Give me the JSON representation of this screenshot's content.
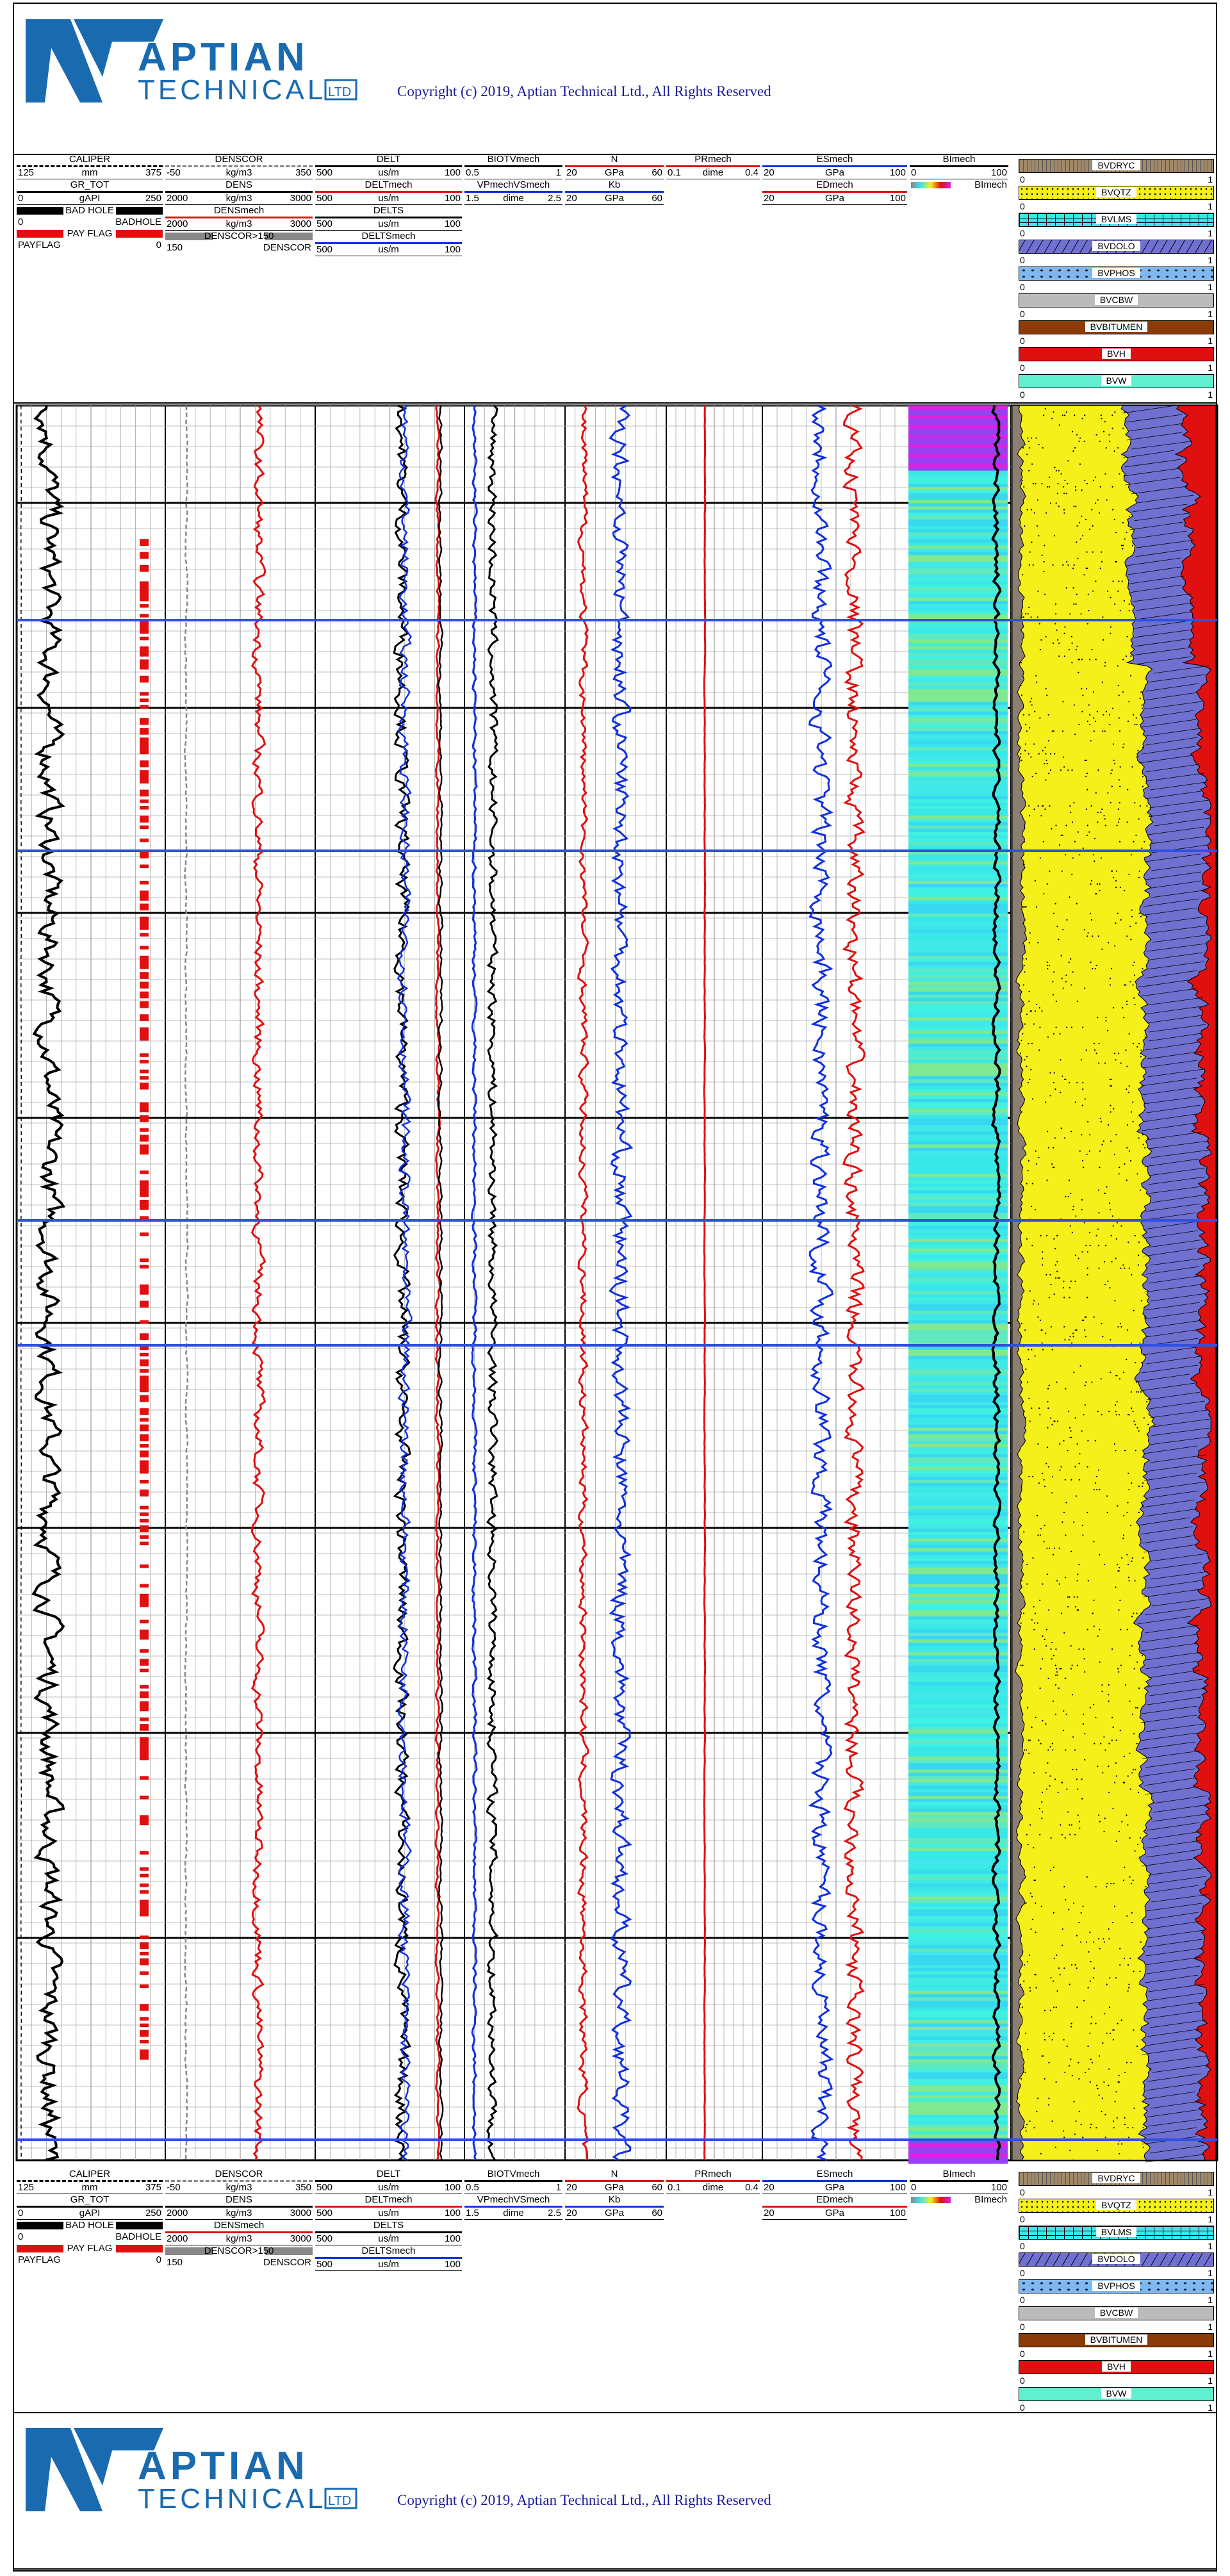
{
  "company": {
    "name": "APTIAN",
    "sub": "TECHNICAL",
    "ltd": "LTD"
  },
  "copyright": "Copyright (c) 2019, Aptian Technical Ltd., All Rights Reserved",
  "colors": {
    "red": "#e01010",
    "blue": "#1030e0",
    "yellow": "#f5f01a",
    "dolo": "#7070d0",
    "cyan": "#38e8e8",
    "brown": "#8b3a0a",
    "bvw": "#60f0d0",
    "gray": "#bbbbbb"
  },
  "tracks": [
    {
      "key": "t1",
      "rows": [
        {
          "name": "CALIPER",
          "unit": "mm",
          "min": "125",
          "max": "375",
          "color": "#000000",
          "dash": true
        },
        {
          "name": "GR_TOT",
          "unit": "gAPI",
          "min": "0",
          "max": "250",
          "color": "#000000"
        },
        {
          "name": "BAD HOLE",
          "unit": "",
          "min": "0",
          "max": "BADHOLE",
          "color": "#000000",
          "flag": true
        },
        {
          "name": "PAY FLAG",
          "unit": "",
          "min": "PAYFLAG",
          "max": "0",
          "color": "#e01010",
          "flag": true
        }
      ]
    },
    {
      "key": "t2",
      "rows": [
        {
          "name": "DENSCOR",
          "unit": "kg/m3",
          "min": "-50",
          "max": "350",
          "color": "#888888",
          "dash": true
        },
        {
          "name": "DENS",
          "unit": "kg/m3",
          "min": "2000",
          "max": "3000",
          "color": "#000000"
        },
        {
          "name": "DENSmech",
          "unit": "kg/m3",
          "min": "2000",
          "max": "3000",
          "color": "#e01010"
        },
        {
          "name": "DENSCOR>150",
          "unit": "",
          "min": "150",
          "max": "DENSCOR",
          "color": "#888888",
          "flag": true
        }
      ]
    },
    {
      "key": "t3",
      "rows": [
        {
          "name": "DELT",
          "unit": "us/m",
          "min": "500",
          "max": "100",
          "color": "#000000"
        },
        {
          "name": "DELTmech",
          "unit": "us/m",
          "min": "500",
          "max": "100",
          "color": "#e01010"
        },
        {
          "name": "DELTS",
          "unit": "us/m",
          "min": "500",
          "max": "100",
          "color": "#000000"
        },
        {
          "name": "DELTSmech",
          "unit": "us/m",
          "min": "500",
          "max": "100",
          "color": "#1030e0"
        }
      ]
    },
    {
      "key": "t4",
      "rows": [
        {
          "name": "BIOTVmech",
          "unit": "",
          "min": "0.5",
          "max": "1",
          "color": "#000000"
        },
        {
          "name": "VPmechVSmech",
          "unit": "dime",
          "min": "1.5",
          "max": "2.5",
          "color": "#1030e0"
        }
      ]
    },
    {
      "key": "t5",
      "rows": [
        {
          "name": "N",
          "unit": "GPa",
          "min": "20",
          "max": "60",
          "color": "#e01010"
        },
        {
          "name": "Kb",
          "unit": "GPa",
          "min": "20",
          "max": "60",
          "color": "#1030e0"
        }
      ]
    },
    {
      "key": "t6",
      "rows": [
        {
          "name": "PRmech",
          "unit": "dime",
          "min": "0.1",
          "max": "0.4",
          "color": "#e01010"
        }
      ]
    },
    {
      "key": "t7",
      "rows": [
        {
          "name": "ESmech",
          "unit": "GPa",
          "min": "20",
          "max": "100",
          "color": "#1030e0"
        },
        {
          "name": "EDmech",
          "unit": "GPa",
          "min": "20",
          "max": "100",
          "color": "#e01010"
        }
      ]
    },
    {
      "key": "t8",
      "rows": [
        {
          "name": "BImech",
          "unit": "",
          "min": "0",
          "max": "100",
          "color": "#000000"
        },
        {
          "name": "",
          "unit": "",
          "min": "0",
          "max": "BImech",
          "color": "#000000",
          "gradient": true
        }
      ]
    }
  ],
  "legend": [
    {
      "name": "BVDRYC",
      "color": "#a0896a",
      "min": "0",
      "max": "1"
    },
    {
      "name": "BVQTZ",
      "color": "#f5f01a",
      "min": "0",
      "max": "1"
    },
    {
      "name": "BVLMS",
      "color": "#38e8e8",
      "min": "0",
      "max": "1"
    },
    {
      "name": "BVDOLO",
      "color": "#7070d0",
      "min": "0",
      "max": "1"
    },
    {
      "name": "BVPHOS",
      "color": "#7fb8f0",
      "min": "0",
      "max": "1"
    },
    {
      "name": "BVCBW",
      "color": "#bbbbbb",
      "min": "0",
      "max": "1"
    },
    {
      "name": "BVBITUMEN",
      "color": "#8b3a0a",
      "min": "0",
      "max": "1"
    },
    {
      "name": "BVH",
      "color": "#e01010",
      "min": "0",
      "max": "1"
    },
    {
      "name": "BVW",
      "color": "#60f0d0",
      "min": "0",
      "max": "1"
    }
  ],
  "chart_data": {
    "type": "line",
    "title": "",
    "depth_axis": "vertical, depth increasing downward (unlabeled)",
    "series": [
      {
        "name": "GR_TOT",
        "track": "t1",
        "range": [
          0,
          250
        ],
        "note": "black curve, typical 30-120 gAPI, more variable in upper section"
      },
      {
        "name": "CALIPER",
        "track": "t1",
        "range": [
          125,
          375
        ],
        "note": "dashed curve near left edge (~130 mm)"
      },
      {
        "name": "PAY FLAG",
        "track": "t1",
        "note": "red flag blocks intermittently along right side of track 1"
      },
      {
        "name": "DENSCOR",
        "track": "t2",
        "range": [
          -50,
          350
        ],
        "note": "gray dashed near ~0 kg/m3"
      },
      {
        "name": "DENSmech",
        "track": "t2",
        "range": [
          2000,
          3000
        ],
        "note": "red curve ~2600-2700 kg/m3"
      },
      {
        "name": "DELT",
        "track": "t3",
        "range": [
          500,
          100
        ],
        "note": "black ~250 us/m"
      },
      {
        "name": "DELTmech",
        "track": "t3",
        "range": [
          500,
          100
        ],
        "note": "red ~160 us/m"
      },
      {
        "name": "DELTS",
        "track": "t3",
        "range": [
          500,
          100
        ],
        "note": "black ~160 us/m"
      },
      {
        "name": "DELTSmech",
        "track": "t3",
        "range": [
          500,
          100
        ],
        "note": "blue ~250 us/m"
      },
      {
        "name": "BIOTVmech",
        "track": "t4",
        "range": [
          0.5,
          1
        ],
        "note": "black ~0.7"
      },
      {
        "name": "VPmechVSmech",
        "track": "t4",
        "range": [
          1.5,
          2.5
        ],
        "note": "blue ~1.65"
      },
      {
        "name": "N",
        "track": "t5",
        "range": [
          20,
          60
        ],
        "note": "red ~25-30 GPa"
      },
      {
        "name": "Kb",
        "track": "t5",
        "range": [
          20,
          60
        ],
        "note": "blue ~35-45 GPa"
      },
      {
        "name": "PRmech",
        "track": "t6",
        "range": [
          0.1,
          0.4
        ],
        "note": "red ~0.22"
      },
      {
        "name": "ESmech",
        "track": "t7",
        "range": [
          20,
          100
        ],
        "note": "blue ~50-60 GPa"
      },
      {
        "name": "EDmech",
        "track": "t7",
        "range": [
          20,
          100
        ],
        "note": "red ~65-75 GPa"
      },
      {
        "name": "BImech",
        "track": "t8",
        "range": [
          0,
          100
        ],
        "note": "black ~80, colored fill by value"
      }
    ],
    "volume_fractions": {
      "track": "t9",
      "order_left_to_right": [
        "BVDRYC",
        "BVQTZ",
        "BVDOLO",
        "BVH"
      ],
      "typical": {
        "BVDRYC": 0.05,
        "BVQTZ": 0.65,
        "BVDOLO": 0.25,
        "BVH": 0.03
      }
    },
    "horizontal_markers": {
      "blue_lines": 5,
      "black_division_lines": 9
    }
  }
}
